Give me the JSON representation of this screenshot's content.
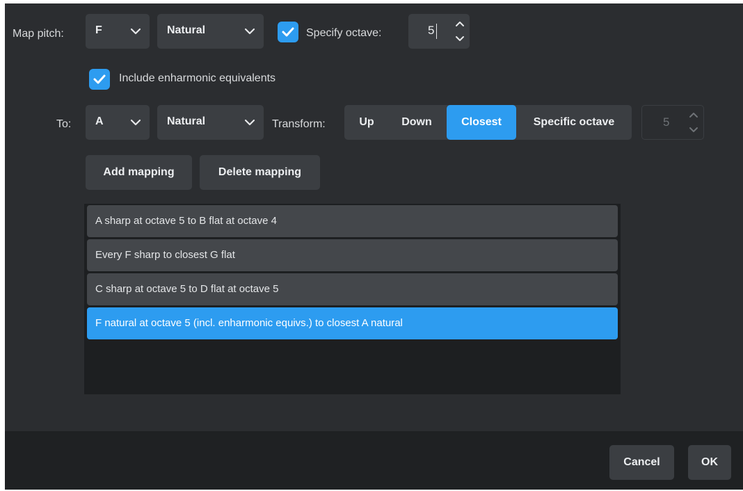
{
  "map_pitch": {
    "label": "Map pitch:",
    "note": "F",
    "accidental": "Natural",
    "specify_octave_checked": true,
    "specify_octave_label": "Specify octave:",
    "octave_value": "5"
  },
  "enharmonic": {
    "checked": true,
    "label": "Include enharmonic equivalents"
  },
  "to": {
    "label": "To:",
    "note": "A",
    "accidental": "Natural",
    "transform_label": "Transform:",
    "transform_options": [
      "Up",
      "Down",
      "Closest",
      "Specific octave"
    ],
    "transform_selected": "Closest",
    "octave_value": "5"
  },
  "actions": {
    "add": "Add mapping",
    "delete": "Delete mapping"
  },
  "mappings": [
    {
      "text": "A sharp at octave 5 to B flat at octave 4",
      "selected": false
    },
    {
      "text": "Every F sharp to closest G flat",
      "selected": false
    },
    {
      "text": "C sharp at octave 5 to D flat at octave 5",
      "selected": false
    },
    {
      "text": "F natural at octave 5 (incl. enharmonic equivs.) to closest A natural",
      "selected": true
    }
  ],
  "footer": {
    "cancel": "Cancel",
    "ok": "OK"
  },
  "colors": {
    "accent": "#2d9cf0",
    "dialog_bg": "#2b2d30",
    "control_bg": "#3b3e42"
  },
  "icons": {
    "dropdown": "chevron-down-icon",
    "checkbox": "checkmark-icon",
    "spin_up": "chevron-up-icon",
    "spin_down": "chevron-down-icon"
  }
}
